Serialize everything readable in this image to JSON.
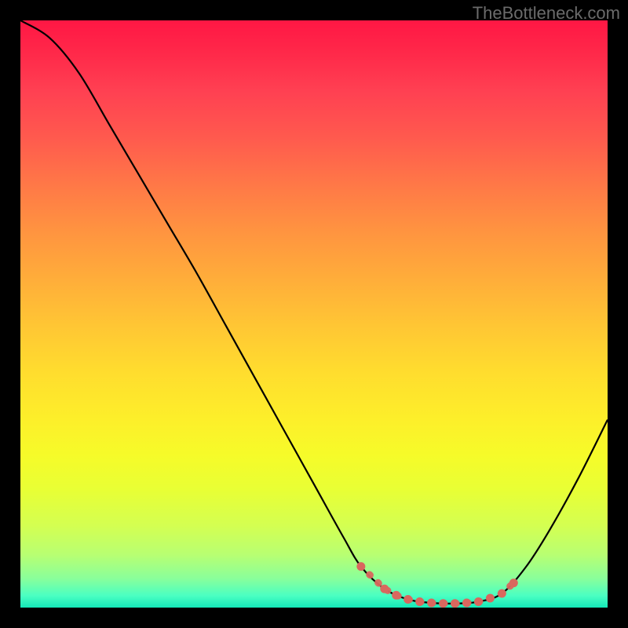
{
  "watermark": "TheBottleneck.com",
  "colors": {
    "background": "#000000",
    "curve": "#000000",
    "marker": "#d9675e"
  },
  "chart_data": {
    "type": "line",
    "title": "",
    "xlabel": "",
    "ylabel": "",
    "xlim": [
      0,
      100
    ],
    "ylim": [
      0,
      100
    ],
    "x": [
      0,
      5,
      10,
      15,
      20,
      25,
      30,
      35,
      40,
      45,
      50,
      55,
      58,
      62,
      66,
      70,
      74,
      78,
      82,
      86,
      90,
      95,
      100
    ],
    "values": [
      100,
      97,
      91,
      82.5,
      74,
      65.5,
      57,
      48,
      39,
      30,
      21,
      12,
      7,
      3.2,
      1.4,
      0.8,
      0.7,
      1.0,
      2.4,
      6.8,
      13,
      22,
      32
    ],
    "marker_region": {
      "x_start": 58,
      "x_end": 84
    },
    "marker_points": [
      {
        "x": 58,
        "y": 7
      },
      {
        "x": 62,
        "y": 3.2
      },
      {
        "x": 64,
        "y": 2.1
      },
      {
        "x": 66,
        "y": 1.4
      },
      {
        "x": 68,
        "y": 1.0
      },
      {
        "x": 70,
        "y": 0.8
      },
      {
        "x": 72,
        "y": 0.7
      },
      {
        "x": 74,
        "y": 0.7
      },
      {
        "x": 76,
        "y": 0.8
      },
      {
        "x": 78,
        "y": 1.0
      },
      {
        "x": 80,
        "y": 1.6
      },
      {
        "x": 82,
        "y": 2.4
      },
      {
        "x": 84,
        "y": 4.2
      }
    ]
  }
}
